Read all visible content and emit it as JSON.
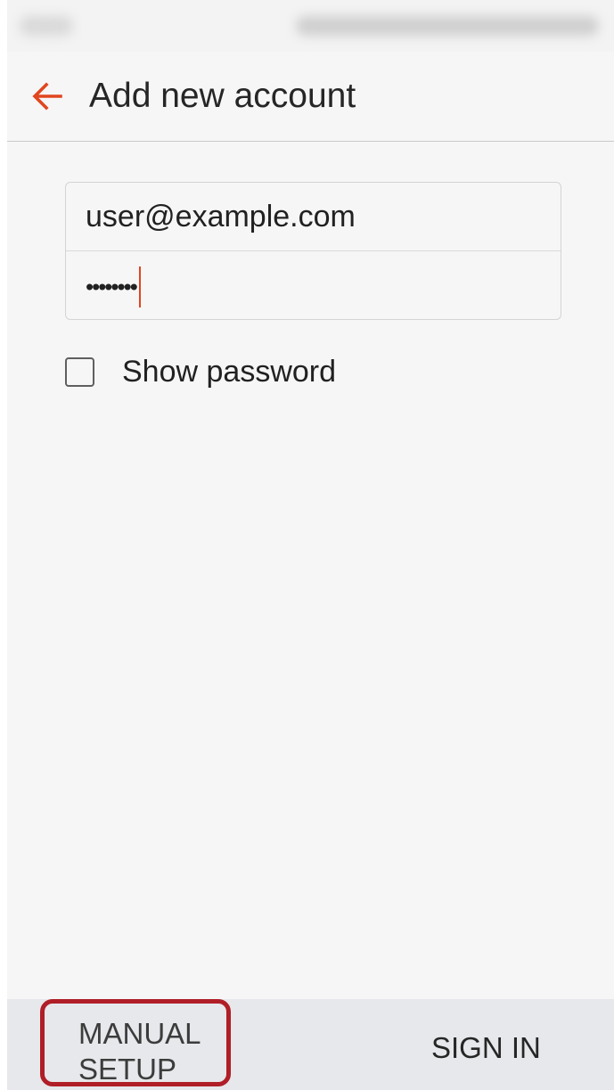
{
  "header": {
    "title": "Add new account",
    "back_icon": "arrow-left-icon"
  },
  "form": {
    "email_value": "user@example.com",
    "password_value": "••••••••",
    "show_password_label": "Show password",
    "show_password_checked": false
  },
  "bottom_bar": {
    "manual_setup_label_line1": "MANUAL",
    "manual_setup_label_line2": "SETUP",
    "sign_in_label": "SIGN IN"
  },
  "colors": {
    "accent": "#e0461f",
    "highlight_border": "#b01e27",
    "bottom_bar_bg": "#e6e8eb",
    "screen_bg": "#f6f6f6"
  }
}
